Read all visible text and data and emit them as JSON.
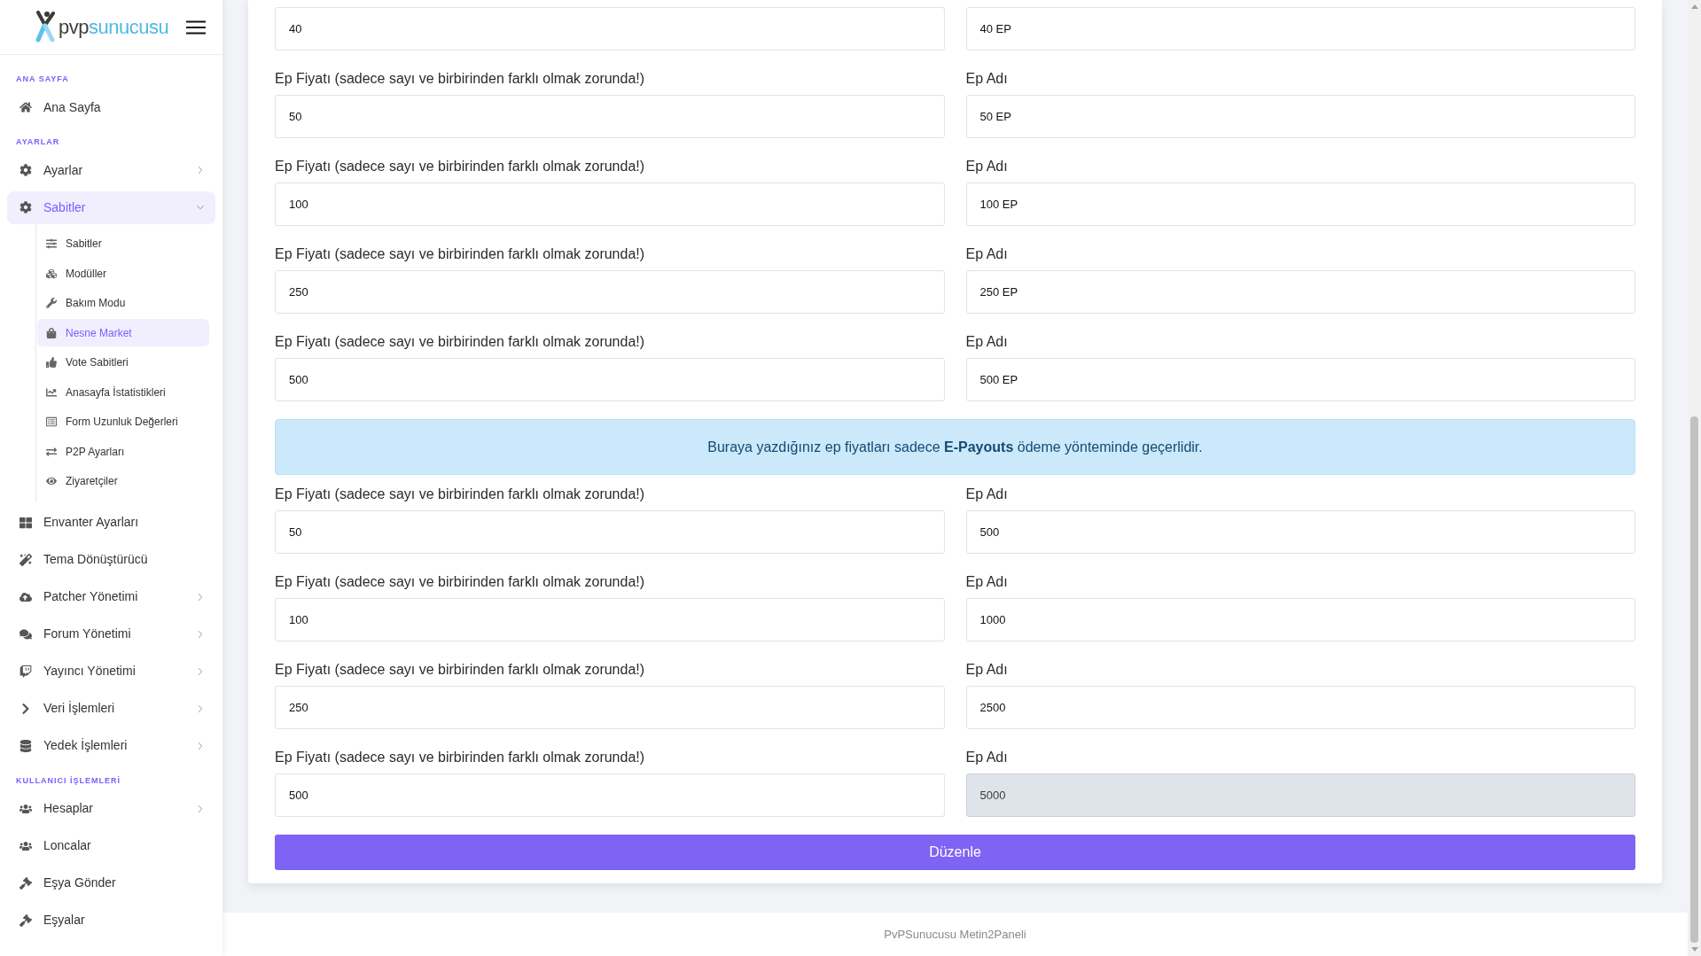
{
  "sidebar": {
    "logo": {
      "prefix": "pvp",
      "suffix": "sunucusu"
    },
    "sections": [
      {
        "title": "ANA SAYFA",
        "items": [
          {
            "label": "Ana Sayfa",
            "selected": false
          }
        ]
      },
      {
        "title": "AYARLAR",
        "items": [
          {
            "label": "Ayarlar",
            "selected": false,
            "expanded": false
          },
          {
            "label": "Sabitler",
            "selected": true,
            "expanded": true,
            "children": [
              {
                "label": "Sabitler",
                "selected": false
              },
              {
                "label": "Modüller",
                "selected": false
              },
              {
                "label": "Bakım Modu",
                "selected": false
              },
              {
                "label": "Nesne Market",
                "selected": true
              },
              {
                "label": "Vote Sabitleri",
                "selected": false
              },
              {
                "label": "Anasayfa İstatistikleri",
                "selected": false
              },
              {
                "label": "Form Uzunluk Değerleri",
                "selected": false
              },
              {
                "label": "P2P Ayarları",
                "selected": false
              },
              {
                "label": "Ziyaretçiler",
                "selected": false
              }
            ]
          },
          {
            "label": "Envanter Ayarları",
            "selected": false
          },
          {
            "label": "Tema Dönüştürücü",
            "selected": false
          },
          {
            "label": "Patcher Yönetimi",
            "selected": false,
            "expanded": false
          },
          {
            "label": "Forum Yönetimi",
            "selected": false,
            "expanded": false
          },
          {
            "label": "Yayıncı Yönetimi",
            "selected": false,
            "expanded": false
          },
          {
            "label": "Veri İşlemleri",
            "selected": false,
            "expanded": false
          },
          {
            "label": "Yedek İşlemleri",
            "selected": false,
            "expanded": false
          }
        ]
      },
      {
        "title": "KULLANICI İŞLEMLERİ",
        "items": [
          {
            "label": "Hesaplar",
            "selected": false,
            "expanded": false
          },
          {
            "label": "Loncalar",
            "selected": false
          },
          {
            "label": "Eşya Gönder",
            "selected": false
          },
          {
            "label": "Eşyalar",
            "selected": false
          }
        ]
      }
    ]
  },
  "form": {
    "rows": [
      {
        "price": {
          "value": "40",
          "disabled": false
        },
        "name": {
          "value": "40 EP",
          "disabled": false
        }
      },
      {
        "price": {
          "label": "Ep Fiyatı (sadece sayı ve birbirinden farklı olmak zorunda!)",
          "value": "50",
          "disabled": false
        },
        "name": {
          "label": "Ep Adı",
          "value": "50 EP",
          "disabled": false
        }
      },
      {
        "price": {
          "label": "Ep Fiyatı (sadece sayı ve birbirinden farklı olmak zorunda!)",
          "value": "100",
          "disabled": false
        },
        "name": {
          "label": "Ep Adı",
          "value": "100 EP",
          "disabled": false
        }
      },
      {
        "price": {
          "label": "Ep Fiyatı (sadece sayı ve birbirinden farklı olmak zorunda!)",
          "value": "250",
          "disabled": false
        },
        "name": {
          "label": "Ep Adı",
          "value": "250 EP",
          "disabled": false
        }
      },
      {
        "price": {
          "label": "Ep Fiyatı (sadece sayı ve birbirinden farklı olmak zorunda!)",
          "value": "500",
          "disabled": false
        },
        "name": {
          "label": "Ep Adı",
          "value": "500 EP",
          "disabled": false
        }
      }
    ],
    "notice": "Buraya yazdığınız ep fiyatları sadece **E-Payouts** ödeme yönteminde geçerlidir.",
    "payout_rows": [
      {
        "price": {
          "label": "Ep Fiyatı (sadece sayı ve birbirinden farklı olmak zorunda!)",
          "value": "50",
          "disabled": false
        },
        "name": {
          "label": "Ep Adı",
          "value": "500",
          "disabled": false
        }
      },
      {
        "price": {
          "label": "Ep Fiyatı (sadece sayı ve birbirinden farklı olmak zorunda!)",
          "value": "100",
          "disabled": false
        },
        "name": {
          "label": "Ep Adı",
          "value": "1000",
          "disabled": false
        }
      },
      {
        "price": {
          "label": "Ep Fiyatı (sadece sayı ve birbirinden farklı olmak zorunda!)",
          "value": "250",
          "disabled": false
        },
        "name": {
          "label": "Ep Adı",
          "value": "2500",
          "disabled": false
        }
      },
      {
        "price": {
          "label": "Ep Fiyatı (sadece sayı ve birbirinden farklı olmak zorunda!)",
          "value": "500",
          "disabled": false
        },
        "name": {
          "label": "Ep Adı",
          "value": "5000",
          "disabled": true
        }
      }
    ],
    "submit_button": "Düzenle"
  },
  "footer": {
    "text": "PvPSunucusu Metin2Paneli"
  }
}
